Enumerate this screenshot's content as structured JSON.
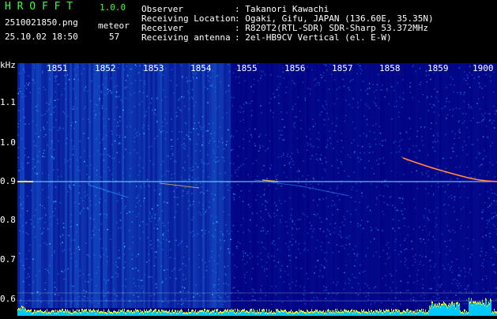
{
  "app": {
    "name": "H R O F F T",
    "version": "1.0.0",
    "filename": "2510021850.png",
    "date_time": "25.10.02 18:50",
    "counter_label": "meteor",
    "counter_value": "57"
  },
  "info": {
    "observer_label": "Observer",
    "observer_value": ": Takanori Kawachi",
    "location_label": "Receiving Location",
    "location_value": ": Ogaki, Gifu, JAPAN (136.60E, 35.35N)",
    "receiver_label": "Receiver",
    "receiver_value": ": R820T2(RTL-SDR) SDR-Sharp 53.372MHz",
    "antenna_label": "Receiving antenna",
    "antenna_value": ": 2el-HB9CV Vertical (el. E-W)"
  },
  "axes": {
    "y_unit": "kHz",
    "y_ticks": [
      "1.1",
      "1.0",
      "0.9",
      "0.8",
      "0.7",
      "0.6"
    ],
    "x_ticks": [
      "1851",
      "1852",
      "1853",
      "1854",
      "1855",
      "1856",
      "1857",
      "1858",
      "1859",
      "1900"
    ]
  },
  "colors": {
    "background": "#000000",
    "spectrogram_base": "#000080",
    "header_accent": "#3cff3c",
    "signal_line": "#ff4040",
    "level_bar": "#00c8ff"
  }
}
